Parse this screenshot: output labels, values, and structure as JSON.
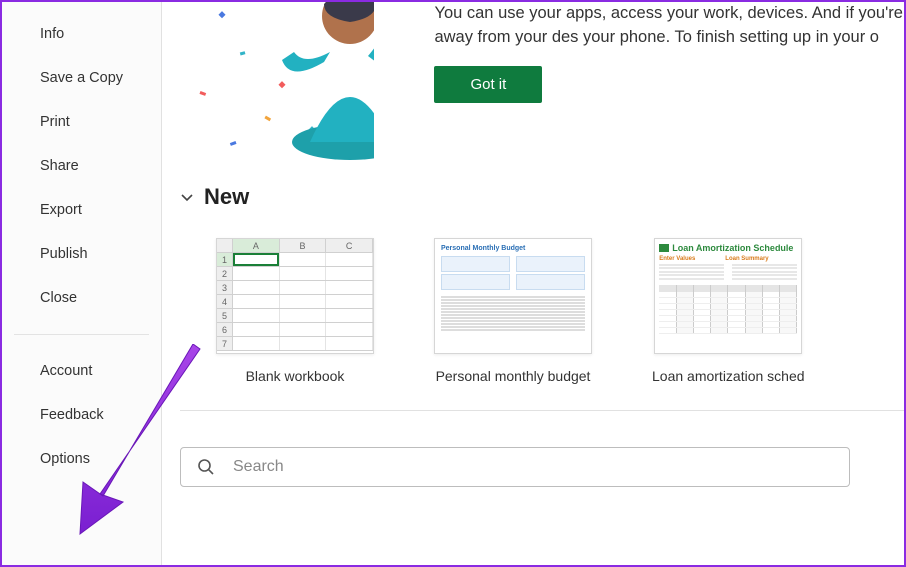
{
  "sidebar": {
    "main_items": [
      {
        "label": "Info"
      },
      {
        "label": "Save a Copy"
      },
      {
        "label": "Print"
      },
      {
        "label": "Share"
      },
      {
        "label": "Export"
      },
      {
        "label": "Publish"
      },
      {
        "label": "Close"
      }
    ],
    "bottom_items": [
      {
        "label": "Account"
      },
      {
        "label": "Feedback"
      },
      {
        "label": "Options"
      }
    ]
  },
  "hero": {
    "text": "You can use your apps, access your work, devices. And if you're away from your des your phone. To finish setting up in your o",
    "button_label": "Got it"
  },
  "new_section": {
    "title": "New",
    "templates": [
      {
        "label": "Blank workbook"
      },
      {
        "label": "Personal monthly budget"
      },
      {
        "label": "Loan amortization sched"
      }
    ]
  },
  "search": {
    "placeholder": "Search"
  },
  "thumbs": {
    "budget_title": "Personal Monthly Budget",
    "loan_title": "Loan Amortization Schedule",
    "loan_head1": "Enter Values",
    "loan_head2": "Loan Summary"
  },
  "colors": {
    "accent": "#0f7b3e",
    "annotation": "#8a2be2"
  }
}
